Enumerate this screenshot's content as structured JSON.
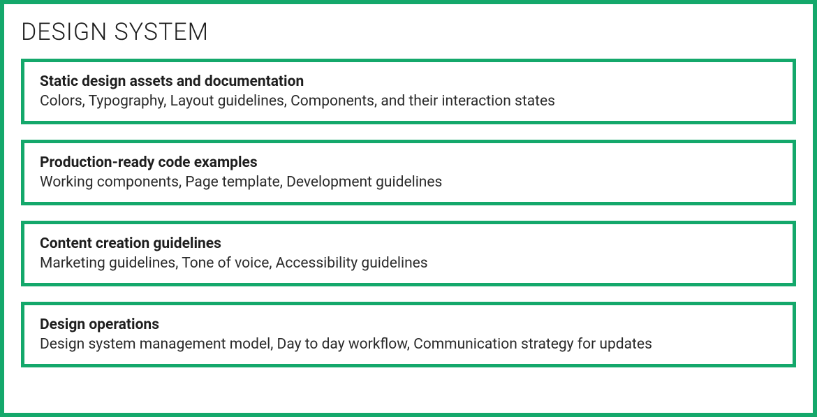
{
  "title": "DESIGN SYSTEM",
  "colors": {
    "accent": "#14a86b",
    "text": "#1e1e1e"
  },
  "cards": [
    {
      "title": "Static design assets and documentation",
      "desc": "Colors, Typography, Layout guidelines, Components, and their interaction states"
    },
    {
      "title": "Production-ready code examples",
      "desc": "Working components, Page template, Development guidelines"
    },
    {
      "title": "Content creation guidelines",
      "desc": "Marketing guidelines, Tone of voice, Accessibility guidelines"
    },
    {
      "title": "Design operations",
      "desc": "Design system management model, Day to day workflow, Communication strategy for updates"
    }
  ]
}
